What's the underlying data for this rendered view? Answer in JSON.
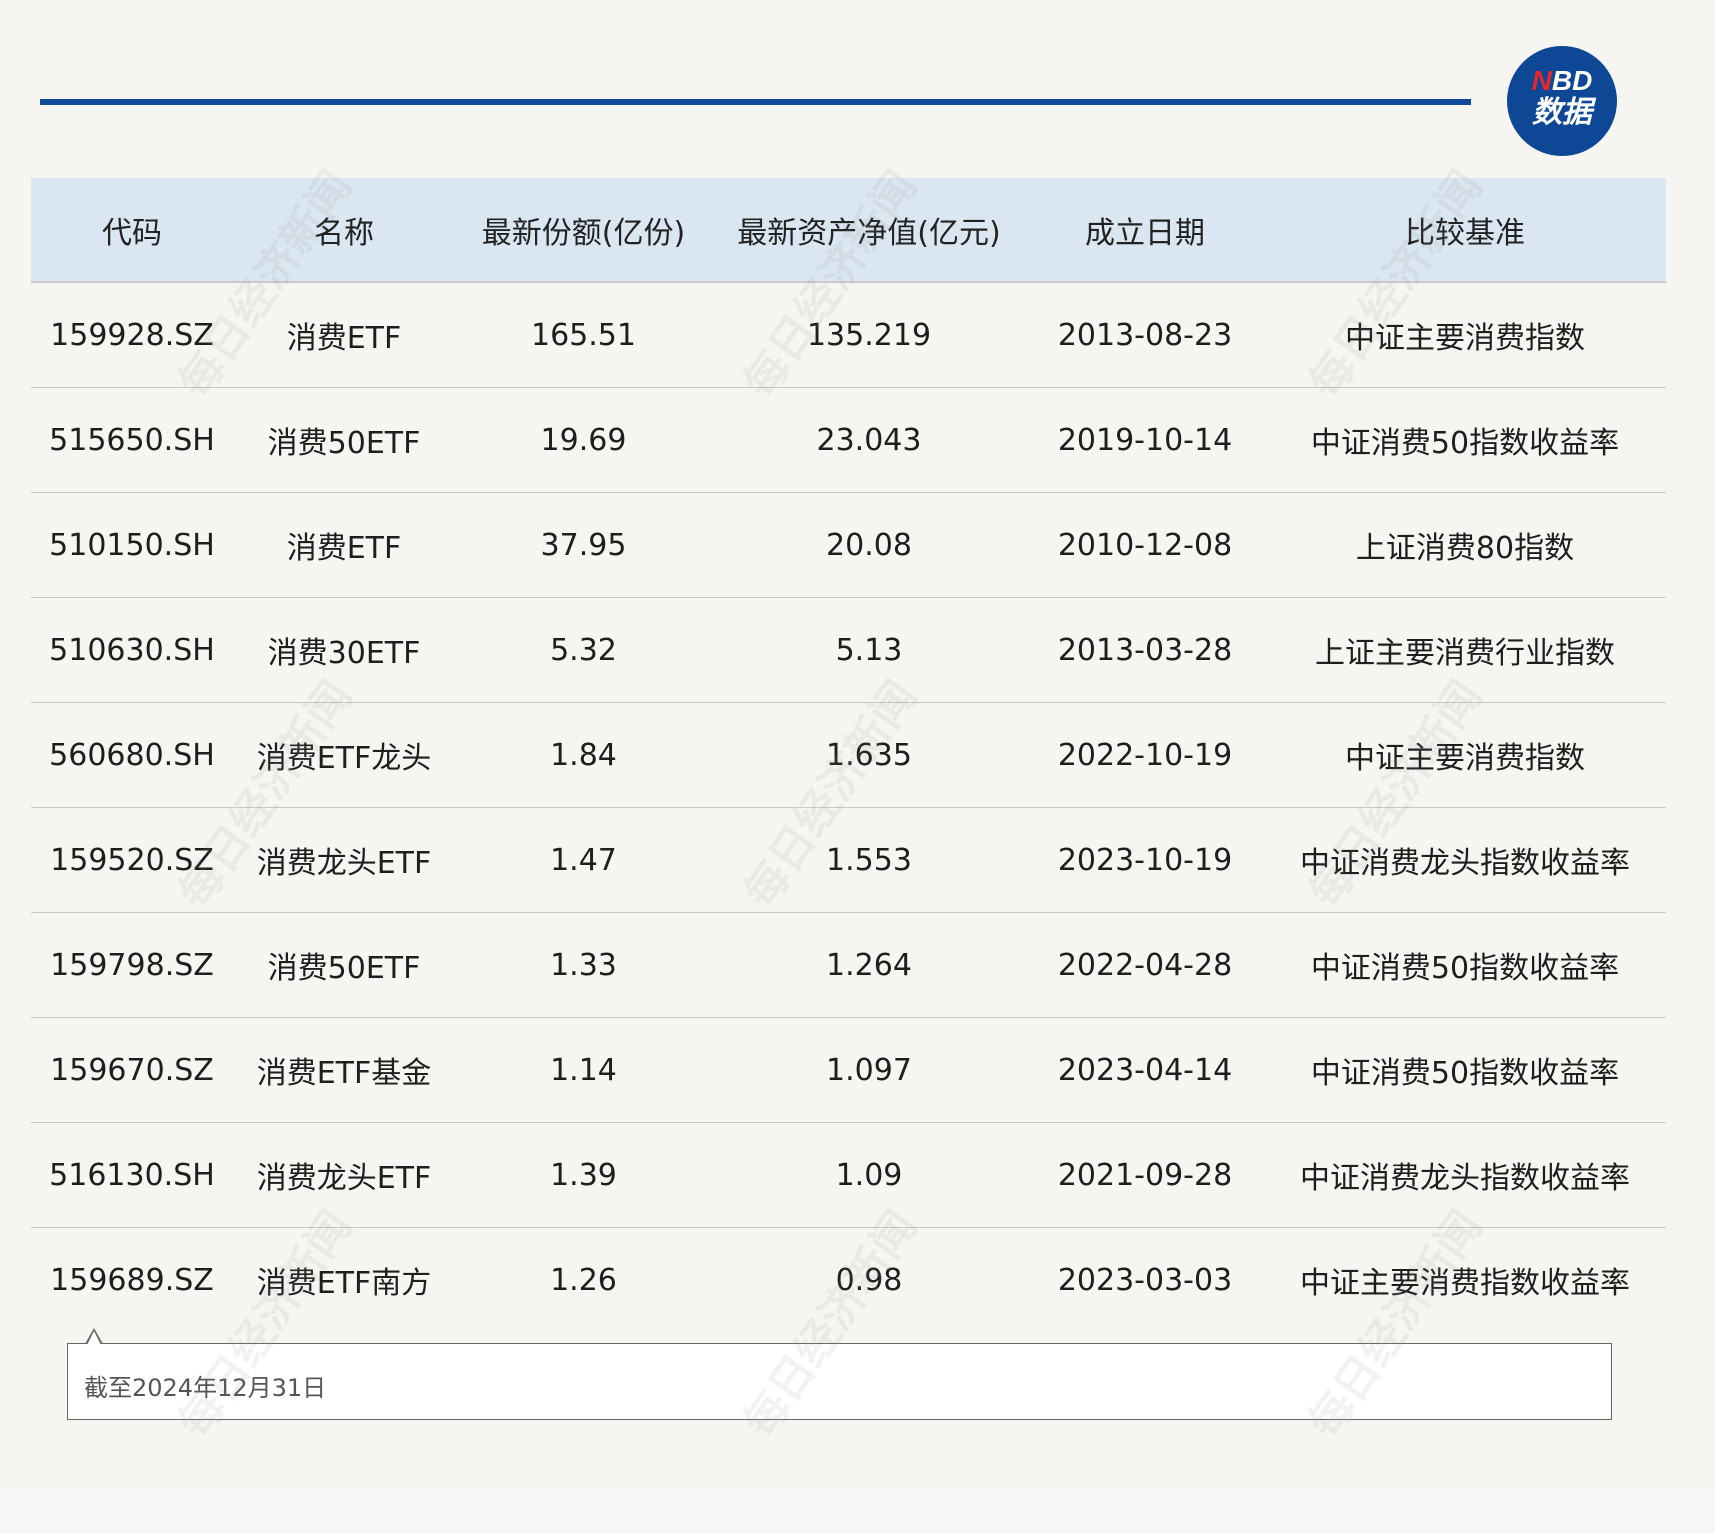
{
  "logo": {
    "line1_n": "N",
    "line1_rest": "BD",
    "line2": "数据"
  },
  "watermark": "每日经济新闻",
  "table": {
    "headers": [
      "代码",
      "名称",
      "最新份额(亿份)",
      "最新资产净值(亿元)",
      "成立日期",
      "比较基准"
    ],
    "rows": [
      [
        "159928.SZ",
        "消费ETF",
        "165.51",
        "135.219",
        "2013-08-23",
        "中证主要消费指数"
      ],
      [
        "515650.SH",
        "消费50ETF",
        "19.69",
        "23.043",
        "2019-10-14",
        "中证消费50指数收益率"
      ],
      [
        "510150.SH",
        "消费ETF",
        "37.95",
        "20.08",
        "2010-12-08",
        "上证消费80指数"
      ],
      [
        "510630.SH",
        "消费30ETF",
        "5.32",
        "5.13",
        "2013-03-28",
        "上证主要消费行业指数"
      ],
      [
        "560680.SH",
        "消费ETF龙头",
        "1.84",
        "1.635",
        "2022-10-19",
        "中证主要消费指数"
      ],
      [
        "159520.SZ",
        "消费龙头ETF",
        "1.47",
        "1.553",
        "2023-10-19",
        "中证消费龙头指数收益率"
      ],
      [
        "159798.SZ",
        "消费50ETF",
        "1.33",
        "1.264",
        "2022-04-28",
        "中证消费50指数收益率"
      ],
      [
        "159670.SZ",
        "消费ETF基金",
        "1.14",
        "1.097",
        "2023-04-14",
        "中证消费50指数收益率"
      ],
      [
        "516130.SH",
        "消费龙头ETF",
        "1.39",
        "1.09",
        "2021-09-28",
        "中证消费龙头指数收益率"
      ],
      [
        "159689.SZ",
        "消费ETF南方",
        "1.26",
        "0.98",
        "2023-03-03",
        "中证主要消费指数收益率"
      ]
    ]
  },
  "note": "截至2024年12月31日"
}
